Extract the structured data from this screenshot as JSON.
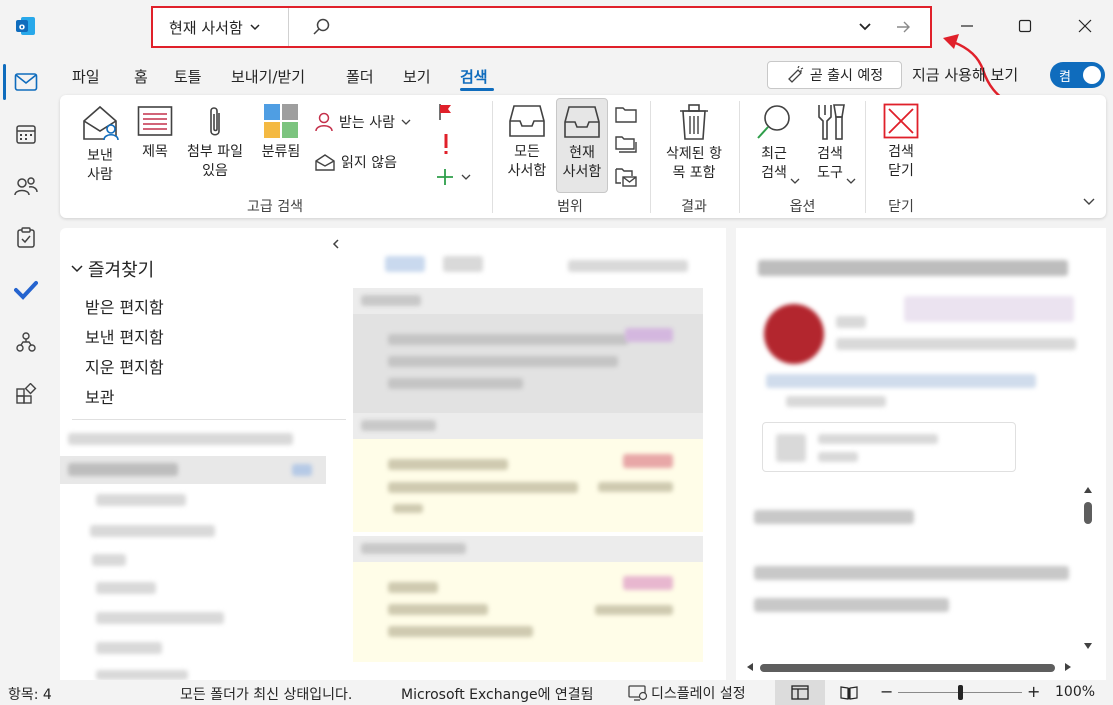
{
  "search": {
    "scope": "현재 사서함",
    "placeholder": ""
  },
  "tabs": [
    "파일",
    "홈",
    "토틀",
    "보내기/받기",
    "폴더",
    "보기",
    "검색"
  ],
  "header_right": {
    "coming_soon": "곧 출시 예정",
    "try_now": "지금 사용해 보기",
    "toggle": "켬"
  },
  "ribbon": {
    "advanced": {
      "sent_to_1": "보낸",
      "sent_to_2": "사람",
      "subject": "제목",
      "has_attach_1": "첨부 파일",
      "has_attach_2": "있음",
      "categorized": "분류됨",
      "to": "받는 사람",
      "unread": "읽지 않음",
      "label": "고급 검색"
    },
    "scope": {
      "all_1": "모든",
      "all_2": "사서함",
      "current_1": "현재",
      "current_2": "사서함",
      "label": "범위"
    },
    "results": {
      "deleted_1": "삭제된 항",
      "deleted_2": "목 포함",
      "label": "결과"
    },
    "options": {
      "recent_1": "최근",
      "recent_2": "검색",
      "tools_1": "검색",
      "tools_2": "도구",
      "label": "옵션"
    },
    "close": {
      "close_1": "검색",
      "close_2": "닫기",
      "label": "닫기"
    }
  },
  "folders": {
    "favorites": "즐겨찾기",
    "items": [
      "받은 편지함",
      "보낸 편지함",
      "지운 편지함",
      "보관"
    ]
  },
  "status": {
    "items": "항목: 4",
    "sync": "모든 폴더가 최신 상태입니다.",
    "connection": "Microsoft Exchange에 연결됨",
    "display": "디스플레이 설정",
    "zoom": "100%",
    "zoom_level": 0.5
  },
  "colors": {
    "accent": "#0f6cbd",
    "highlight": "#e0202a",
    "unread_bg": "#fffde8"
  }
}
